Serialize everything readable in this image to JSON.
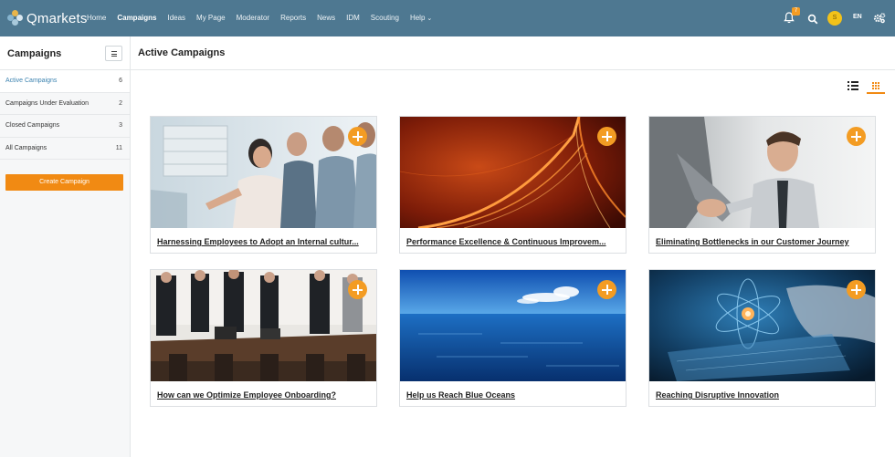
{
  "brand": {
    "name": "Qmarkets",
    "accent": "#f18a13",
    "bar_color": "#4e7891"
  },
  "nav": {
    "items": [
      {
        "label": "Home",
        "active": false
      },
      {
        "label": "Campaigns",
        "active": true
      },
      {
        "label": "Ideas",
        "active": false
      },
      {
        "label": "My Page",
        "active": false
      },
      {
        "label": "Moderator",
        "active": false
      },
      {
        "label": "Reports",
        "active": false
      },
      {
        "label": "News",
        "active": false
      },
      {
        "label": "IDM",
        "active": false
      },
      {
        "label": "Scouting",
        "active": false
      },
      {
        "label": "Help",
        "active": false
      }
    ],
    "notifications_count": "7",
    "avatar_initial": "S",
    "language": "EN"
  },
  "sidebar": {
    "title": "Campaigns",
    "items": [
      {
        "label": "Active Campaigns",
        "count": "6",
        "active": true
      },
      {
        "label": "Campaigns Under Evaluation",
        "count": "2",
        "active": false
      },
      {
        "label": "Closed Campaigns",
        "count": "3",
        "active": false
      },
      {
        "label": "All Campaigns",
        "count": "11",
        "active": false
      }
    ],
    "create_label": "Create Campaign"
  },
  "main": {
    "title": "Active Campaigns",
    "campaigns": [
      {
        "title": "Harnessing Employees to Adopt an Internal cultur...",
        "image": "office-glass-team"
      },
      {
        "title": "Performance Excellence & Continuous Improvem...",
        "image": "orange-abstract-curve"
      },
      {
        "title": "Eliminating Bottlenecks in our Customer Journey",
        "image": "businessmen-handshake"
      },
      {
        "title": "How can we Optimize Employee Onboarding?",
        "image": "meeting-room"
      },
      {
        "title": "Help us Reach Blue Oceans",
        "image": "blue-ocean"
      },
      {
        "title": "Reaching Disruptive Innovation",
        "image": "hand-atom-tech"
      }
    ]
  }
}
